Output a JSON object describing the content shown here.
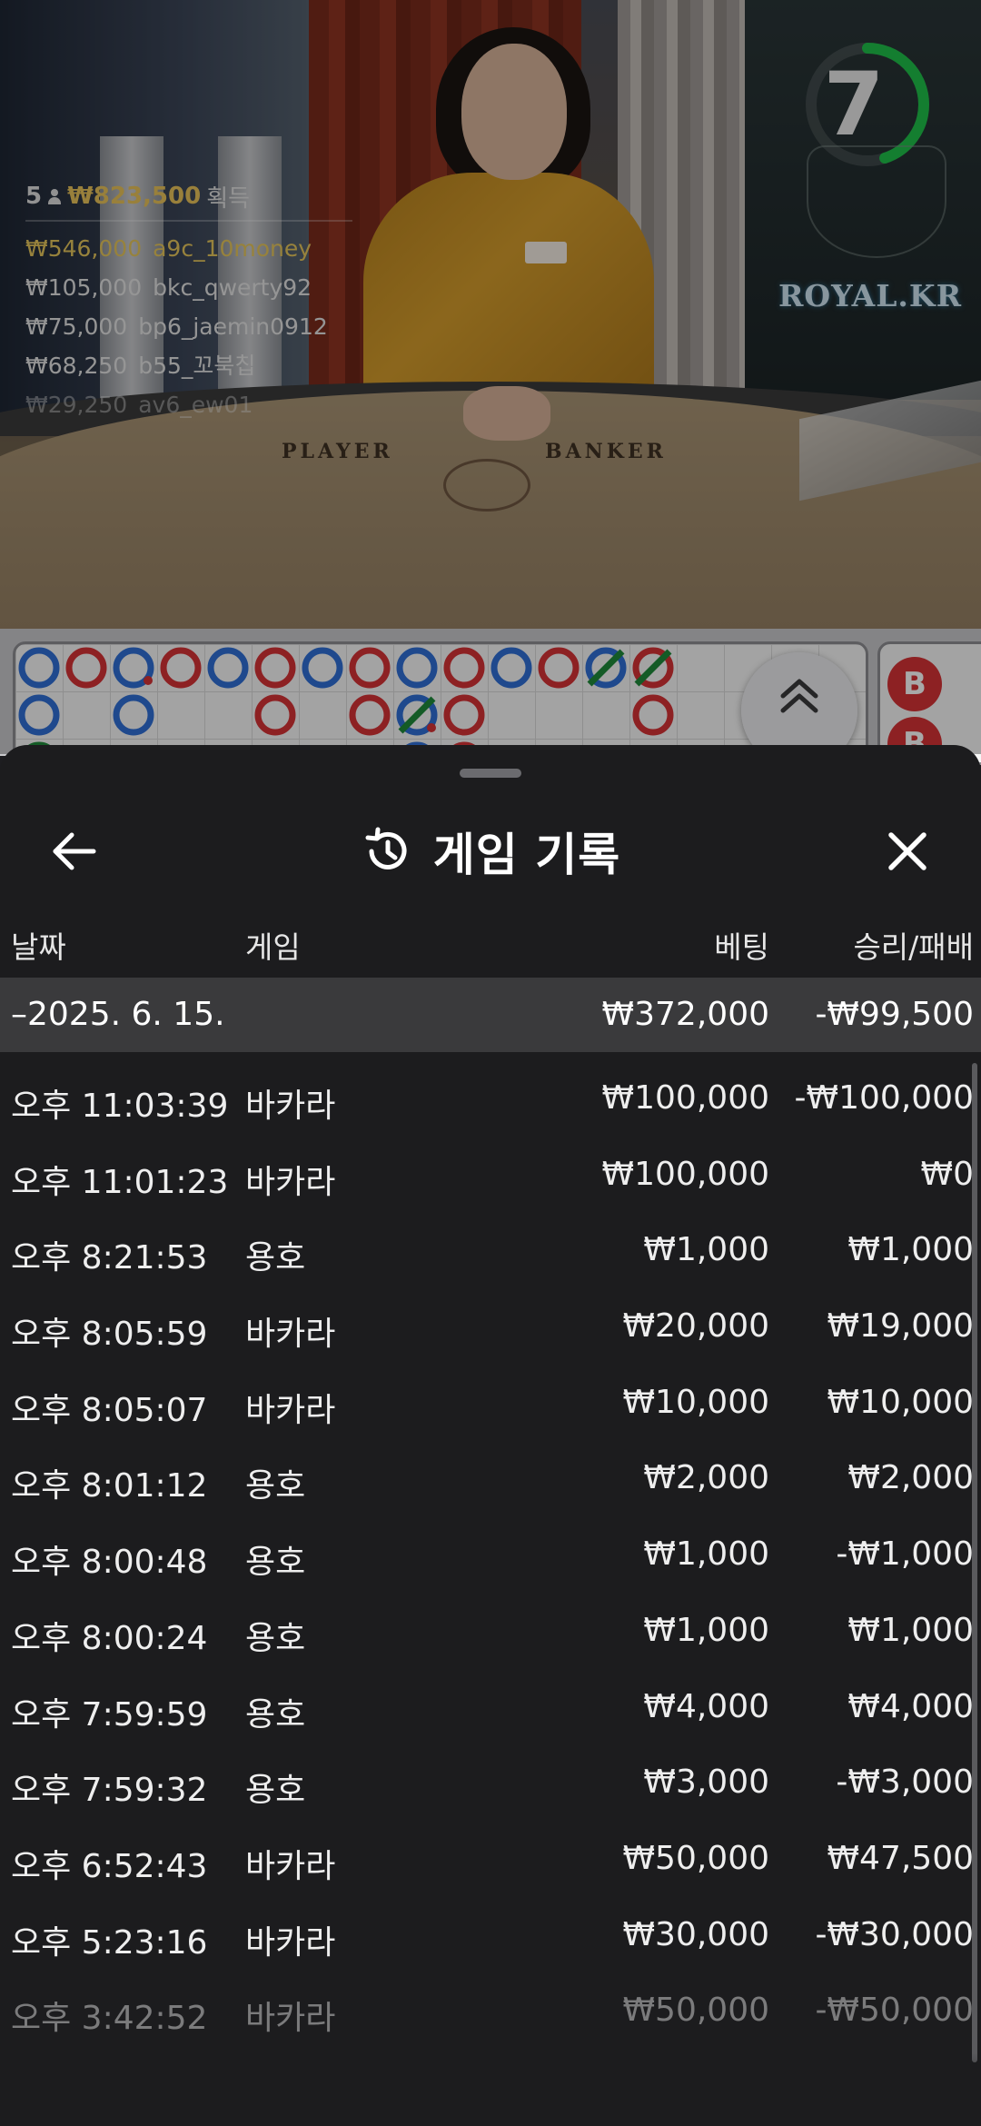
{
  "stream": {
    "timer_value": "7",
    "brand": "ROYAL.KR",
    "table_labels": {
      "player": "PLAYER",
      "banker": "BANKER"
    },
    "winners": {
      "count": "5",
      "total": "₩823,500",
      "label": "획득",
      "list": [
        {
          "amount": "₩546,000",
          "name": "a9c_10money"
        },
        {
          "amount": "₩105,000",
          "name": "bkc_qwerty92"
        },
        {
          "amount": "₩75,000",
          "name": "bp6_jaemin0912"
        },
        {
          "amount": "₩68,250",
          "name": "b55_꼬북칩"
        },
        {
          "amount": "₩29,250",
          "name": "av6_ew01"
        }
      ]
    }
  },
  "road": {
    "side_marker": "B"
  },
  "sheet": {
    "title": "게임 기록",
    "columns": {
      "date": "날짜",
      "game": "게임",
      "bet": "베팅",
      "result": "승리/패배"
    },
    "summary": {
      "date": "–2025. 6. 15.",
      "bet": "₩372,000",
      "result": "-₩99,500"
    },
    "records": [
      {
        "time": "오후 11:03:39",
        "game": "바카라",
        "bet": "₩100,000",
        "result": "-₩100,000"
      },
      {
        "time": "오후 11:01:23",
        "game": "바카라",
        "bet": "₩100,000",
        "result": "₩0"
      },
      {
        "time": "오후 8:21:53",
        "game": "용호",
        "bet": "₩1,000",
        "result": "₩1,000"
      },
      {
        "time": "오후 8:05:59",
        "game": "바카라",
        "bet": "₩20,000",
        "result": "₩19,000"
      },
      {
        "time": "오후 8:05:07",
        "game": "바카라",
        "bet": "₩10,000",
        "result": "₩10,000"
      },
      {
        "time": "오후 8:01:12",
        "game": "용호",
        "bet": "₩2,000",
        "result": "₩2,000"
      },
      {
        "time": "오후 8:00:48",
        "game": "용호",
        "bet": "₩1,000",
        "result": "-₩1,000"
      },
      {
        "time": "오후 8:00:24",
        "game": "용호",
        "bet": "₩1,000",
        "result": "₩1,000"
      },
      {
        "time": "오후 7:59:59",
        "game": "용호",
        "bet": "₩4,000",
        "result": "₩4,000"
      },
      {
        "time": "오후 7:59:32",
        "game": "용호",
        "bet": "₩3,000",
        "result": "-₩3,000"
      },
      {
        "time": "오후 6:52:43",
        "game": "바카라",
        "bet": "₩50,000",
        "result": "₩47,500"
      },
      {
        "time": "오후 5:23:16",
        "game": "바카라",
        "bet": "₩30,000",
        "result": "-₩30,000"
      },
      {
        "time": "오후 3:42:52",
        "game": "바카라",
        "bet": "₩50,000",
        "result": "-₩50,000"
      }
    ]
  },
  "colors": {
    "sheet_bg": "#1c1c1e",
    "summary_bg": "#3a3a3c",
    "banker_red": "#d63236",
    "player_blue": "#2f6fd6",
    "tie_green": "#1f8a3a",
    "winner_gold": "#e5c65c",
    "timer_green": "#1fbf4a"
  },
  "icons": {
    "back": "arrow-left-icon",
    "history": "history-clock-icon",
    "close": "close-icon",
    "collapse": "chevron-double-up-icon",
    "player_count": "person-icon"
  }
}
